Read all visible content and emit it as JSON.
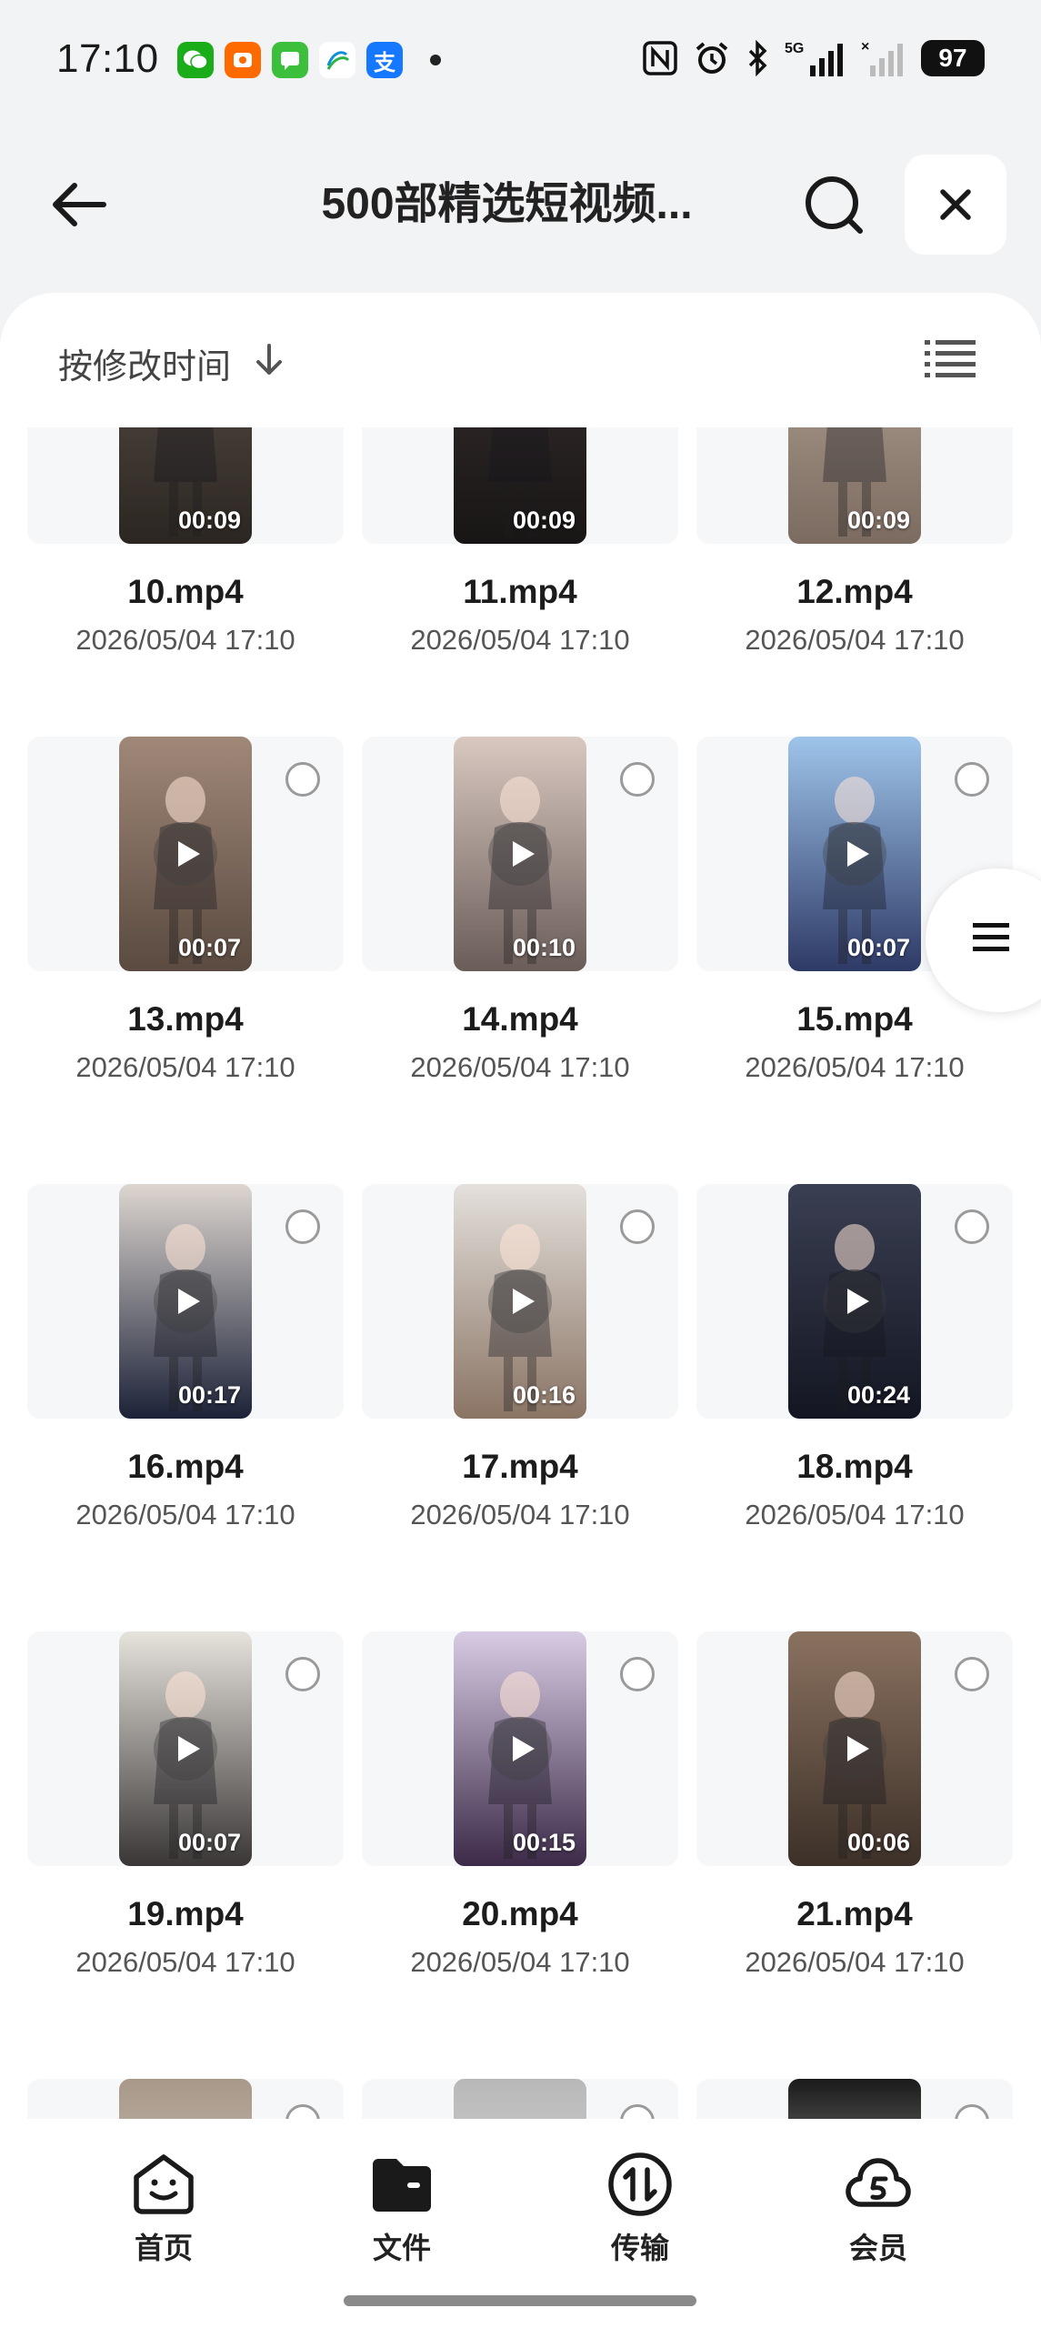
{
  "status_bar": {
    "time": "17:10",
    "apps": [
      {
        "icon": "wechat-icon",
        "color": "#1aad19",
        "glyph": "W"
      },
      {
        "icon": "taobao-icon",
        "color": "#ff6a00",
        "glyph": "淘"
      },
      {
        "icon": "messages-icon",
        "color": "#3cc03c",
        "glyph": "▭"
      },
      {
        "icon": "china-mobile-icon",
        "color": "#ffffff",
        "glyph": ""
      },
      {
        "icon": "alipay-icon",
        "color": "#1677ff",
        "glyph": "支"
      }
    ],
    "battery": "97",
    "network": "5G"
  },
  "header": {
    "title": "500部精选短视频...",
    "back_icon": "arrow-left-icon",
    "search_icon": "search-icon",
    "close_icon": "close-icon"
  },
  "sort": {
    "label": "按修改时间",
    "direction_icon": "arrow-down-icon",
    "view_icon": "list-view-icon"
  },
  "files": [
    {
      "name": "10.mp4",
      "date": "2026/05/04 17:10",
      "duration": "00:09",
      "colors": [
        "#5c5048",
        "#2b2622"
      ]
    },
    {
      "name": "11.mp4",
      "date": "2026/05/04 17:10",
      "duration": "00:09",
      "colors": [
        "#3a3230",
        "#181515"
      ]
    },
    {
      "name": "12.mp4",
      "date": "2026/05/04 17:10",
      "duration": "00:09",
      "colors": [
        "#b8a89a",
        "#7b6b60"
      ]
    },
    {
      "name": "13.mp4",
      "date": "2026/05/04 17:10",
      "duration": "00:07",
      "colors": [
        "#a08878",
        "#5a4a40"
      ]
    },
    {
      "name": "14.mp4",
      "date": "2026/05/04 17:10",
      "duration": "00:10",
      "colors": [
        "#d8c8c0",
        "#6a5c58"
      ]
    },
    {
      "name": "15.mp4",
      "date": "2026/05/04 17:10",
      "duration": "00:07",
      "colors": [
        "#9ec4ea",
        "#2e3a66"
      ]
    },
    {
      "name": "16.mp4",
      "date": "2026/05/04 17:10",
      "duration": "00:17",
      "colors": [
        "#ddd6d0",
        "#1c2238"
      ]
    },
    {
      "name": "17.mp4",
      "date": "2026/05/04 17:10",
      "duration": "00:16",
      "colors": [
        "#e4e0dc",
        "#8a7464"
      ]
    },
    {
      "name": "18.mp4",
      "date": "2026/05/04 17:10",
      "duration": "00:24",
      "colors": [
        "#3a3f52",
        "#131622"
      ]
    },
    {
      "name": "19.mp4",
      "date": "2026/05/04 17:10",
      "duration": "00:07",
      "colors": [
        "#e6e2dc",
        "#3a3636"
      ]
    },
    {
      "name": "20.mp4",
      "date": "2026/05/04 17:10",
      "duration": "00:15",
      "colors": [
        "#d8cce4",
        "#3c2a48"
      ]
    },
    {
      "name": "21.mp4",
      "date": "2026/05/04 17:10",
      "duration": "00:06",
      "colors": [
        "#8a7260",
        "#3c3028"
      ]
    },
    {
      "name": "",
      "date": "",
      "duration": "",
      "colors": [
        "#a89888",
        "#e0dcd8"
      ]
    },
    {
      "name": "",
      "date": "",
      "duration": "",
      "colors": [
        "#b8b8b8",
        "#e8e8e8"
      ]
    },
    {
      "name": "",
      "date": "",
      "duration": "",
      "colors": [
        "#1a1a1a",
        "#eeeae6"
      ]
    }
  ],
  "side_handle_icon": "menu-icon",
  "bottom_nav": [
    {
      "label": "首页",
      "icon": "home-face-icon"
    },
    {
      "label": "文件",
      "icon": "folder-icon"
    },
    {
      "label": "传输",
      "icon": "transfer-icon"
    },
    {
      "label": "会员",
      "icon": "vip-cloud-icon"
    }
  ]
}
